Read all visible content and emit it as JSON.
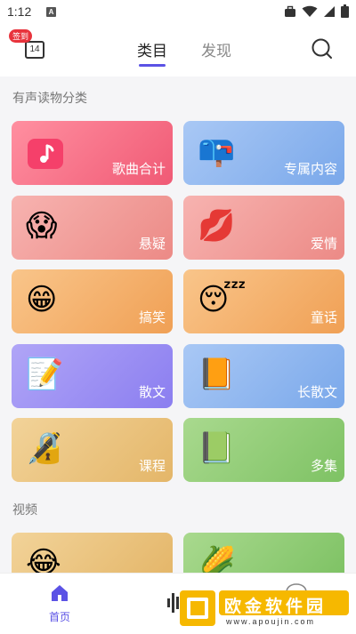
{
  "status": {
    "time": "1:12",
    "a_label": "A"
  },
  "header": {
    "checkin_badge": "签到",
    "checkin_day": "14",
    "tabs": [
      {
        "label": "类目"
      },
      {
        "label": "发现"
      }
    ]
  },
  "sections": [
    {
      "title": "有声读物分类"
    },
    {
      "title": "视频"
    }
  ],
  "cards": [
    {
      "label": "歌曲合计",
      "icon": "music-note-icon"
    },
    {
      "label": "专属内容",
      "icon": "mailbox-icon"
    },
    {
      "label": "悬疑",
      "icon": "screaming-face-icon"
    },
    {
      "label": "爱情",
      "icon": "kiss-mark-icon"
    },
    {
      "label": "搞笑",
      "icon": "grinning-face-icon"
    },
    {
      "label": "童话",
      "icon": "sleeping-face-icon"
    },
    {
      "label": "散文",
      "icon": "memo-icon"
    },
    {
      "label": "长散文",
      "icon": "orange-book-icon"
    },
    {
      "label": "课程",
      "icon": "locked-pen-icon"
    },
    {
      "label": "多集",
      "icon": "green-book-icon"
    }
  ],
  "video_cards": [
    {
      "icon": "tears-of-joy-face-icon"
    },
    {
      "icon": "corn-icon"
    }
  ],
  "nav": {
    "home_label": "首页"
  },
  "watermark": {
    "text": "欧金软件园",
    "url": "www.apoujin.com"
  },
  "colors": {
    "accent": "#5b52e5"
  }
}
